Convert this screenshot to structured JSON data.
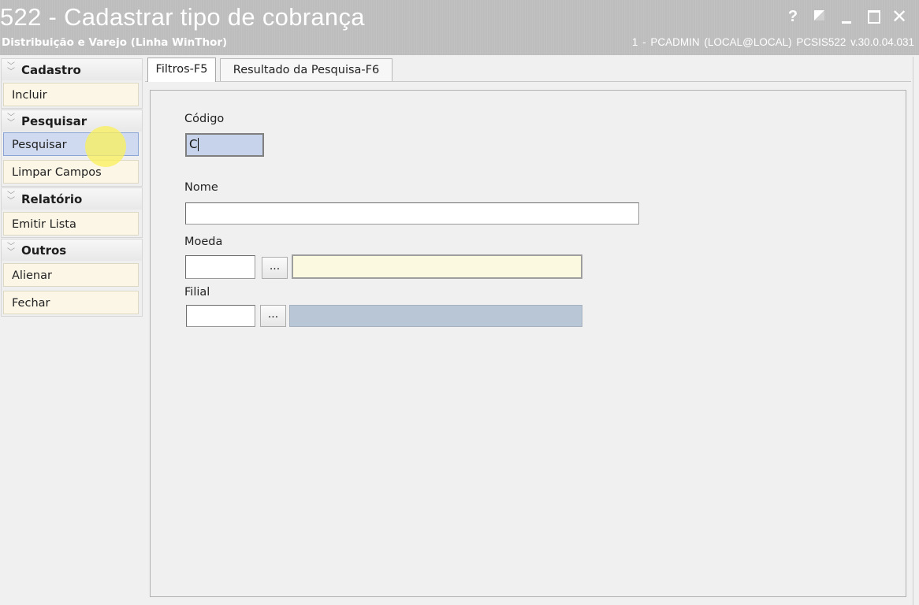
{
  "window": {
    "title": "522 - Cadastrar tipo de cobrança",
    "subtitle": "Distribuição e Varejo (Linha WinThor)",
    "user_info": "1 - PCADMIN (LOCAL@LOCAL)   PCSIS522  v.30.0.04.031",
    "controls": {
      "help": "?",
      "close": "✕"
    }
  },
  "sidebar": {
    "groups": [
      {
        "title": "Cadastro",
        "items": [
          "Incluir"
        ]
      },
      {
        "title": "Pesquisar",
        "items": [
          "Pesquisar",
          "Limpar Campos"
        ]
      },
      {
        "title": "Relatório",
        "items": [
          "Emitir Lista"
        ]
      },
      {
        "title": "Outros",
        "items": [
          "Alienar",
          "Fechar"
        ]
      }
    ],
    "selected_item": "Pesquisar"
  },
  "tabs": [
    {
      "label": "Filtros-F5",
      "active": true
    },
    {
      "label": "Resultado da Pesquisa-F6",
      "active": false
    }
  ],
  "form": {
    "codigo": {
      "label": "Código",
      "value": "C"
    },
    "nome": {
      "label": "Nome",
      "value": ""
    },
    "moeda": {
      "label": "Moeda",
      "code": "",
      "button": "...",
      "description": ""
    },
    "filial": {
      "label": "Filial",
      "code": "",
      "button": "...",
      "description": ""
    }
  },
  "colors": {
    "titlebar": "#bdbdbd",
    "selected_item": "#cfd9ef",
    "focused_field": "#c7d3ea",
    "readonly_field": "#b9c6d5",
    "yellow_field": "#fbf9df",
    "cursor_highlight": "#faf05a"
  }
}
